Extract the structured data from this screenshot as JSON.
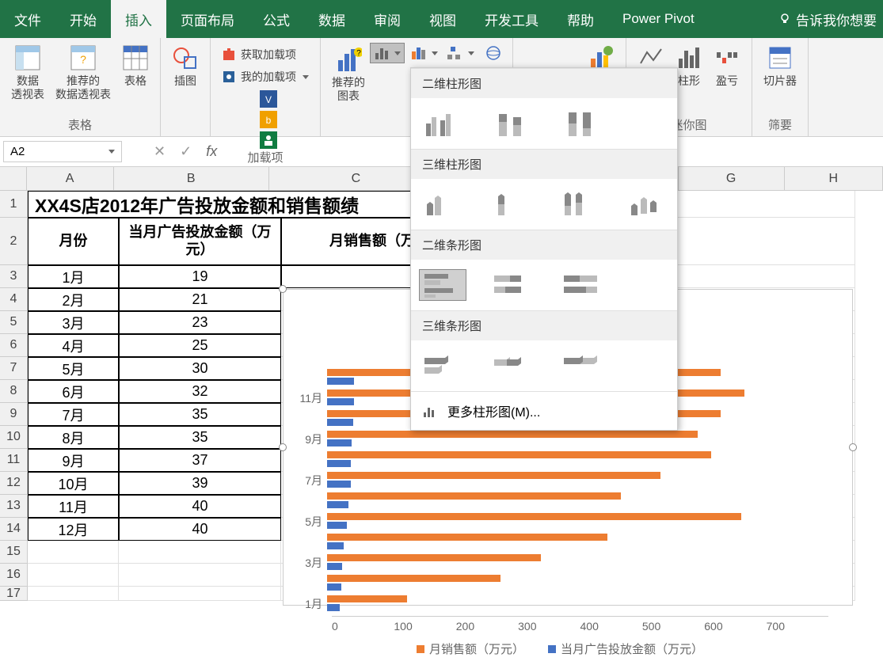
{
  "tabs": {
    "file": "文件",
    "home": "开始",
    "insert": "插入",
    "layout": "页面布局",
    "formulas": "公式",
    "data": "数据",
    "review": "审阅",
    "view": "视图",
    "dev": "开发工具",
    "help": "帮助",
    "powerpivot": "Power Pivot",
    "tellme": "告诉我你想要"
  },
  "ribbon": {
    "pivot": "数据\n透视表",
    "recpivot": "推荐的\n数据透视表",
    "table": "表格",
    "group_tables": "表格",
    "illus": "插图",
    "getaddins": "获取加载项",
    "myaddins": "我的加载项",
    "group_addins": "加载项",
    "rec_charts": "推荐的\n图表",
    "maps": "地",
    "sparkline_line": "折线",
    "sparkline_col": "柱形",
    "sparkline_wl": "盈亏",
    "group_spark": "迷你图",
    "slicer": "切片器",
    "group_filter": "筛要"
  },
  "namebox": "A2",
  "sheet": {
    "cols": [
      "A",
      "B",
      "C",
      "G",
      "H"
    ],
    "title": "XX4S店2012年广告投放金额和销售额绩",
    "headers": {
      "month": "月份",
      "ad": "当月广告投放金额（万元）",
      "sales": "月销售额（万"
    },
    "rows": [
      {
        "m": "1月",
        "ad": "19"
      },
      {
        "m": "2月",
        "ad": "21"
      },
      {
        "m": "3月",
        "ad": "23"
      },
      {
        "m": "4月",
        "ad": "25"
      },
      {
        "m": "5月",
        "ad": "30"
      },
      {
        "m": "6月",
        "ad": "32"
      },
      {
        "m": "7月",
        "ad": "35"
      },
      {
        "m": "8月",
        "ad": "35"
      },
      {
        "m": "9月",
        "ad": "37"
      },
      {
        "m": "10月",
        "ad": "39"
      },
      {
        "m": "11月",
        "ad": "40"
      },
      {
        "m": "12月",
        "ad": "40"
      }
    ]
  },
  "dropdown": {
    "sec_2d_col": "二维柱形图",
    "sec_3d_col": "三维柱形图",
    "sec_2d_bar": "二维条形图",
    "sec_3d_bar": "三维条形图",
    "more": "更多柱形图(M)..."
  },
  "chart_data": {
    "type": "bar",
    "title": "",
    "xlabel": "",
    "ylabel": "",
    "xlim": [
      0,
      700
    ],
    "ticks": [
      0,
      100,
      200,
      300,
      400,
      500,
      600,
      700
    ],
    "legend": [
      "月销售额（万元）",
      "当月广告投放金额（万元）"
    ],
    "colors": {
      "sales": "#ed7d31",
      "ad": "#4472c4"
    },
    "categories": [
      "1月",
      "2月",
      "3月",
      "4月",
      "5月",
      "6月",
      "7月",
      "8月",
      "9月",
      "10月",
      "11月",
      "12月"
    ],
    "visible_y_labels": [
      "1月",
      "3月",
      "5月",
      "7月",
      "9月",
      "11月"
    ],
    "series": [
      {
        "name": "月销售额（万元）",
        "values": [
          120,
          260,
          320,
          420,
          620,
          440,
          500,
          575,
          555,
          590,
          625,
          590
        ]
      },
      {
        "name": "当月广告投放金额（万元）",
        "values": [
          19,
          21,
          23,
          25,
          30,
          32,
          35,
          35,
          37,
          39,
          40,
          40
        ]
      }
    ]
  }
}
